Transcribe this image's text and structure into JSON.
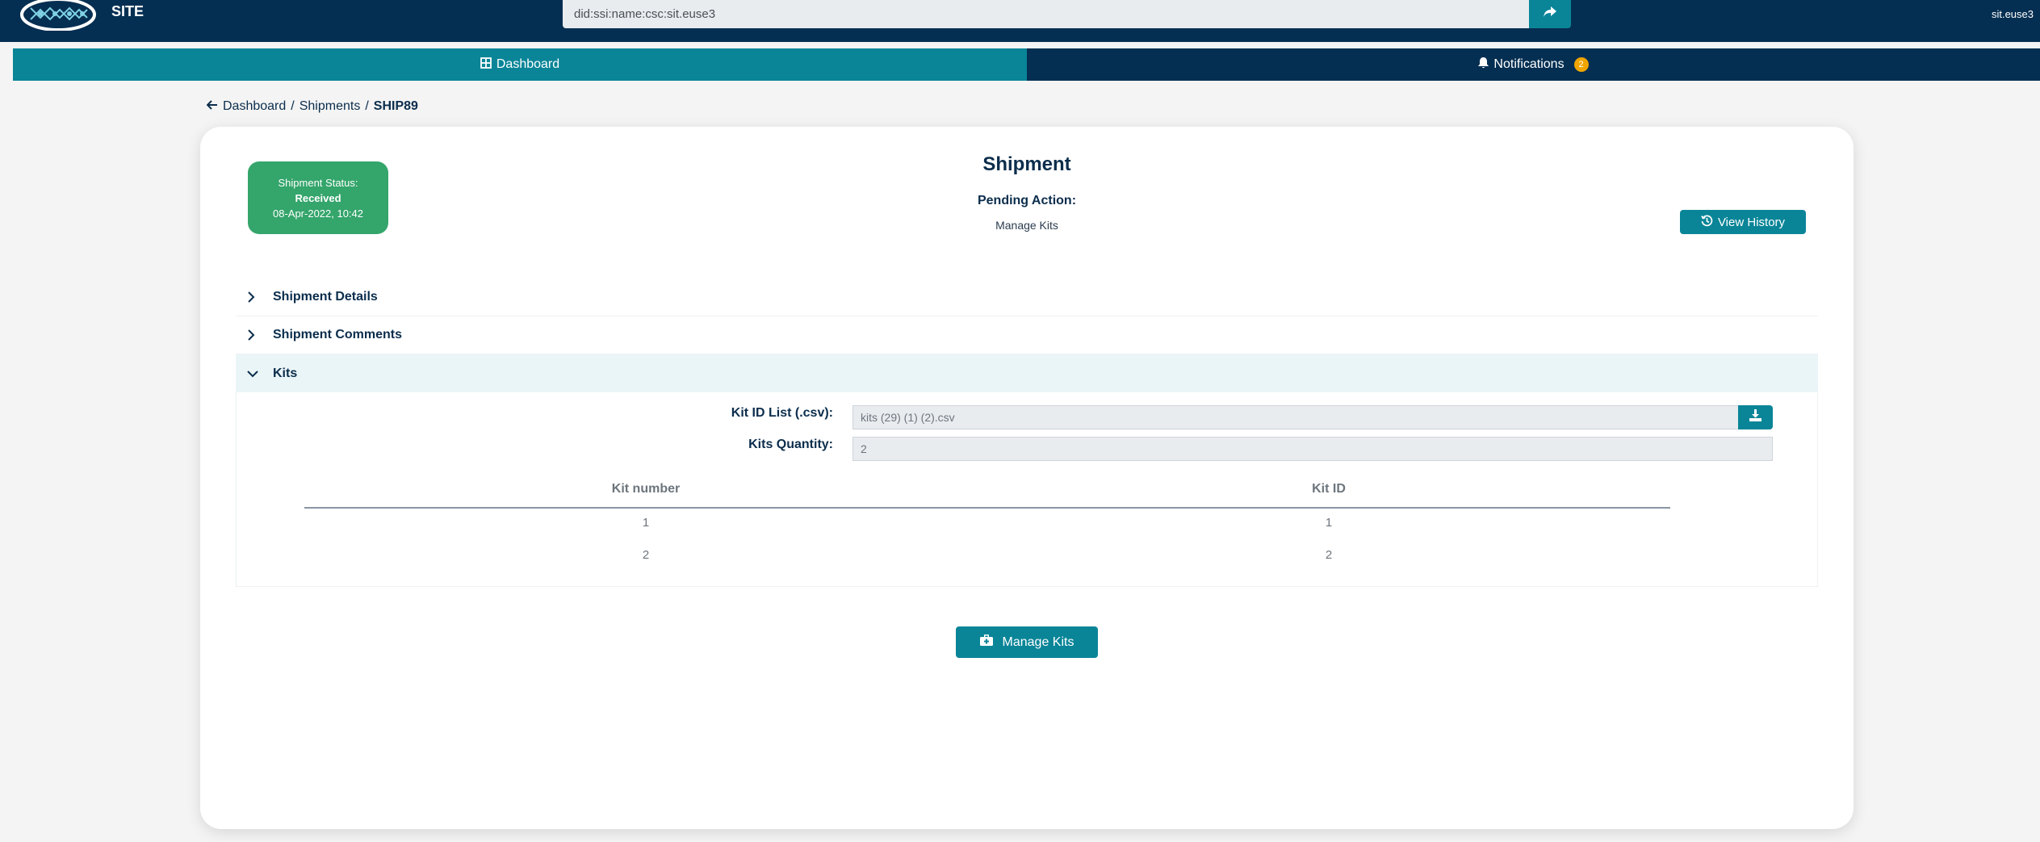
{
  "header": {
    "site_title": "SITE",
    "did_value": "did:ssi:name:csc:sit.euse3",
    "user": "sit.euse3"
  },
  "nav": {
    "dashboard": "Dashboard",
    "notifications": "Notifications",
    "notifications_count": "2"
  },
  "breadcrumb": {
    "items": [
      "Dashboard",
      "Shipments"
    ],
    "separator": "/",
    "current": "SHIP89"
  },
  "status": {
    "label": "Shipment Status:",
    "value": "Received",
    "timestamp": "08-Apr-2022, 10:42"
  },
  "card": {
    "title": "Shipment",
    "pending_label": "Pending Action:",
    "pending_value": "Manage Kits",
    "history_button": "View History"
  },
  "sections": {
    "details": "Shipment Details",
    "comments": "Shipment Comments",
    "kits": "Kits"
  },
  "kits": {
    "csv_label": "Kit ID List (.csv):",
    "csv_value": "kits (29) (1) (2).csv",
    "quantity_label": "Kits Quantity:",
    "quantity_value": "2",
    "table": {
      "headers": [
        "Kit number",
        "Kit ID"
      ],
      "rows": [
        [
          "1",
          "1"
        ],
        [
          "2",
          "2"
        ]
      ]
    },
    "manage_button": "Manage Kits"
  },
  "colors": {
    "navy": "#052f52",
    "teal": "#0a8598",
    "green": "#34a56b",
    "badge": "#f0a500"
  },
  "icons": [
    "logo-icon",
    "share-arrow-icon",
    "dashboard-grid-icon",
    "bell-icon",
    "arrow-left-icon",
    "history-icon",
    "chevron-right-icon",
    "chevron-down-icon",
    "download-icon",
    "briefcase-medical-icon"
  ]
}
